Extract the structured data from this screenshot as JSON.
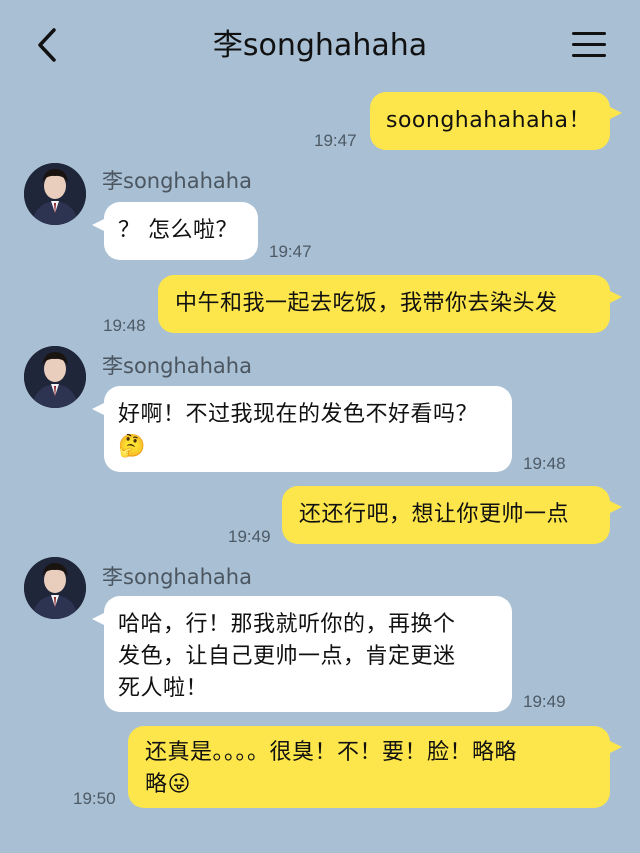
{
  "header": {
    "title": "李songhahaha",
    "back_icon": "chevron-left-icon",
    "menu_icon": "hamburger-menu-icon"
  },
  "contact": {
    "name": "李songhahaha"
  },
  "messages": [
    {
      "from": "me",
      "text": "soonghahahaha！",
      "time": "19:47"
    },
    {
      "from": "them",
      "text": "？ 怎么啦？",
      "time": "19:47"
    },
    {
      "from": "me",
      "text": "中午和我一起去吃饭，我带你去染头发",
      "time": "19:48"
    },
    {
      "from": "them",
      "line1": "好啊！不过我现在的发色不好看吗？",
      "line2": "🤔",
      "time": "19:48"
    },
    {
      "from": "me",
      "text": "还还行吧，想让你更帅一点",
      "time": "19:49"
    },
    {
      "from": "them",
      "line1": "哈哈，行！那我就听你的，再换个",
      "line2": "发色，让自己更帅一点，肯定更迷",
      "line3": "死人啦！",
      "time": "19:49"
    },
    {
      "from": "me",
      "line1": "还真是。。。。很臭！不！要！脸！略略",
      "line2": "略😜",
      "time": "19:50"
    }
  ],
  "colors": {
    "background": "#a8bfd4",
    "my_bubble": "#fde64b",
    "their_bubble": "#ffffff"
  }
}
